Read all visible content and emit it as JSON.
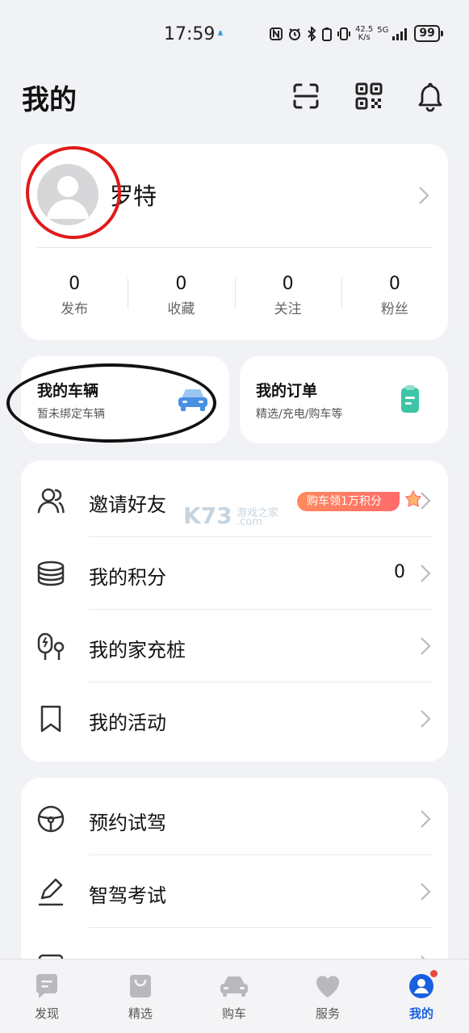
{
  "status_bar": {
    "time": "17:59",
    "net_speed_value": "42.5",
    "net_speed_unit": "K/s",
    "signal": "5G",
    "battery": "99"
  },
  "header": {
    "title": "我的"
  },
  "profile": {
    "username": "罗特",
    "stats": [
      {
        "value": "0",
        "label": "发布"
      },
      {
        "value": "0",
        "label": "收藏"
      },
      {
        "value": "0",
        "label": "关注"
      },
      {
        "value": "0",
        "label": "粉丝"
      }
    ]
  },
  "quick": {
    "vehicle": {
      "title": "我的车辆",
      "subtitle": "暂未绑定车辆"
    },
    "orders": {
      "title": "我的订单",
      "subtitle": "精选/充电/购车等"
    }
  },
  "menu1": [
    {
      "label": "邀请好友",
      "badge": "购车领1万积分"
    },
    {
      "label": "我的积分",
      "value": "0"
    },
    {
      "label": "我的家充桩"
    },
    {
      "label": "我的活动"
    }
  ],
  "menu2": [
    {
      "label": "预约试驾"
    },
    {
      "label": "智驾考试"
    }
  ],
  "watermark": {
    "brand": "K73",
    "cn": "游戏之家",
    "domain": ".com"
  },
  "bottom_nav": [
    {
      "label": "发现"
    },
    {
      "label": "精选"
    },
    {
      "label": "购车"
    },
    {
      "label": "服务"
    },
    {
      "label": "我的"
    }
  ],
  "colors": {
    "accent": "#1a5fe0",
    "badge": "#ff7a5c",
    "notification_dot": "#e8483e",
    "annotation_red": "#e01a1a",
    "annotation_black": "#111111"
  }
}
